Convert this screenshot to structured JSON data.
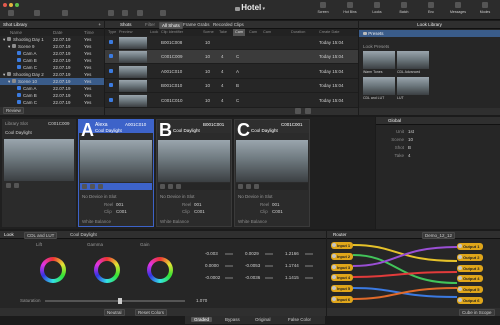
{
  "window": {
    "title": "Hotel"
  },
  "toolbar": {
    "right_labels": [
      "Screen",
      "Hot Bins",
      "Looks",
      "Batch",
      "Enc",
      "Messages",
      "Modes"
    ]
  },
  "shot_library": {
    "title": "Shot Library",
    "header_cols": [
      "Name",
      "Date",
      "Time"
    ],
    "items": [
      {
        "name": "Shooting Day 1",
        "date": "22.07.19",
        "time": "Yes",
        "level": 0
      },
      {
        "name": "Scene 9",
        "date": "22.07.19",
        "time": "Yes",
        "level": 1
      },
      {
        "name": "Cam A",
        "date": "22.07.19",
        "time": "Yes",
        "level": 2
      },
      {
        "name": "Cam B",
        "date": "22.07.19",
        "time": "Yes",
        "level": 2
      },
      {
        "name": "Cam C",
        "date": "22.07.19",
        "time": "Yes",
        "level": 2
      },
      {
        "name": "Shooting Day 2",
        "date": "22.07.19",
        "time": "Yes",
        "level": 0
      },
      {
        "name": "Scene 10",
        "date": "22.07.19",
        "time": "Yes",
        "level": 1
      },
      {
        "name": "Cam A",
        "date": "22.07.19",
        "time": "Yes",
        "level": 2
      },
      {
        "name": "Cam B",
        "date": "22.07.19",
        "time": "Yes",
        "level": 2
      },
      {
        "name": "Cam C",
        "date": "22.07.19",
        "time": "Yes",
        "level": 2
      }
    ],
    "footer": "Review"
  },
  "shots": {
    "title": "Shots",
    "filter_label": "Filter",
    "tabs": [
      "All Shots",
      "Frame Grabs",
      "Recorded Clips"
    ],
    "columns": [
      "Type",
      "Preview",
      "Look",
      "Clip Identifier",
      "Scene",
      "Take",
      "Cam",
      "Cam",
      "Cam",
      "Duration",
      "Create Date"
    ],
    "rows": [
      {
        "clip": "B001C008",
        "scene": "10",
        "take": "",
        "cam": "",
        "date": "Today 15:04"
      },
      {
        "clip": "C001C009",
        "scene": "10",
        "take": "4",
        "cam": "C",
        "date": "Today 15:04"
      },
      {
        "clip": "A001C010",
        "scene": "10",
        "take": "4",
        "cam": "A",
        "date": "Today 15:04"
      },
      {
        "clip": "B001C010",
        "scene": "10",
        "take": "4",
        "cam": "B",
        "date": "Today 15:04"
      },
      {
        "clip": "C001C010",
        "scene": "10",
        "take": "4",
        "cam": "C",
        "date": "Today 15:04"
      }
    ]
  },
  "look_library": {
    "title": "Look Library",
    "presets_label": "Presets",
    "look_presets_label": "Look Presets",
    "presets": [
      "Warm Tones",
      "CDL Advanced",
      "CDL and LUT",
      "LUT"
    ]
  },
  "live_grade": {
    "library_slot": "Library Slot",
    "library_clip": "C001C009",
    "library_look": "Cool Daylight",
    "slots": [
      {
        "letter": "A",
        "camera": "Alexa",
        "clip": "A001C010",
        "look": "Cool Daylight",
        "color": "#3d63c9",
        "device": "No Device in Slot",
        "reel": "001",
        "clip_no": "C001",
        "wb": "White Balance"
      },
      {
        "letter": "B",
        "camera": "",
        "clip": "B001C001",
        "look": "Cool Daylight",
        "color": "#2e2e2e",
        "device": "No Device in Slot",
        "reel": "001",
        "clip_no": "C001",
        "wb": "White Balance"
      },
      {
        "letter": "C",
        "camera": "",
        "clip": "C001C001",
        "look": "Cool Daylight",
        "color": "#2e2e2e",
        "device": "No Device in Slot",
        "reel": "001",
        "clip_no": "C001",
        "wb": "White Balance"
      }
    ],
    "field_labels": {
      "reel": "Reel",
      "clip": "Clip"
    }
  },
  "global": {
    "title": "Global",
    "fields": [
      {
        "label": "Unit",
        "value": "1st"
      },
      {
        "label": "Scene",
        "value": "10"
      },
      {
        "label": "Shot",
        "value": "B"
      },
      {
        "label": "Take",
        "value": "4"
      }
    ]
  },
  "look": {
    "title": "Look",
    "mode": "CDL and LUT",
    "name": "Cool Daylight",
    "wheel_labels": [
      "Lift",
      "Gamma",
      "Gain"
    ],
    "saturation_label": "Saturation",
    "saturation_value": "1.070",
    "numeric_cols": [
      [
        "-0.003",
        "0.0000",
        "-0.0002"
      ],
      [
        "0.0029",
        "-0.0053",
        "-0.0036"
      ],
      [
        "1.2166",
        "1.1744",
        "1.1415"
      ]
    ],
    "bottom_buttons": [
      "Neutral",
      "Reset Colors"
    ]
  },
  "router": {
    "title": "Router",
    "preset": "Demo_12_12",
    "inputs": [
      "Input 1",
      "Input 2",
      "Input 3",
      "Input 4",
      "Input 5",
      "Input 6"
    ],
    "outputs": [
      "Output 1",
      "Output 2",
      "Output 3",
      "Output 4",
      "Output 5",
      "Output 6"
    ]
  },
  "bottom_bar": {
    "buttons": [
      "Graded",
      "Bypass",
      "Original",
      "False Color"
    ],
    "right": "Cube in Scope"
  }
}
